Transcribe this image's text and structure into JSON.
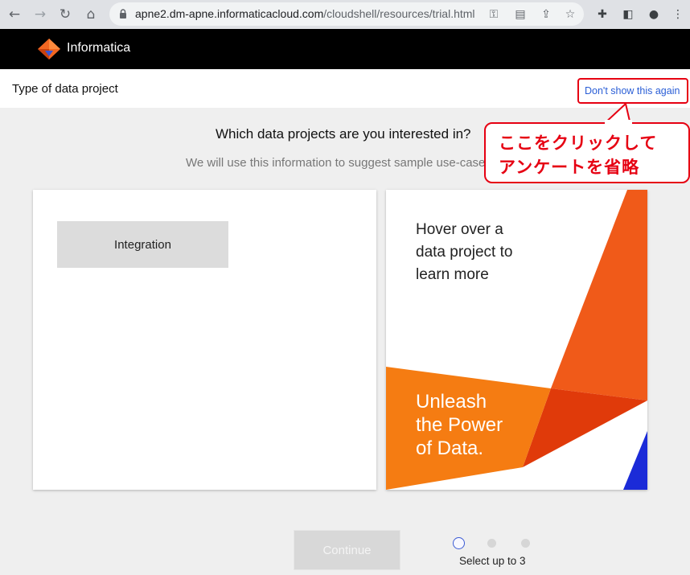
{
  "browser": {
    "url_host": "apne2.dm-apne.informaticacloud.com",
    "url_path": "/cloudshell/resources/trial.html"
  },
  "app": {
    "logo_text": "Informatica",
    "brand_colors": {
      "orange": "#f26722",
      "dark_orange": "#e85112",
      "header_bg": "#000000"
    }
  },
  "titlebar": {
    "title": "Type of data project",
    "dont_show_label": "Don't show this again"
  },
  "question": {
    "heading": "Which data projects are you interested in?",
    "subtext": "We will use this information to suggest sample use-cases."
  },
  "callout": {
    "line1": "ここをクリックして",
    "line2": "アンケートを省略",
    "color": "#e60012"
  },
  "projects": {
    "items": [
      {
        "label": "Integration"
      }
    ]
  },
  "promo": {
    "hover_line1": "Hover over a",
    "hover_line2": "data project to",
    "hover_line3": "learn more",
    "unleash_line1": "Unleash",
    "unleash_line2": "the Power",
    "unleash_line3": "of Data."
  },
  "footer": {
    "continue_label": "Continue",
    "select_hint": "Select up to 3",
    "step_count": 3,
    "current_step": 1
  }
}
